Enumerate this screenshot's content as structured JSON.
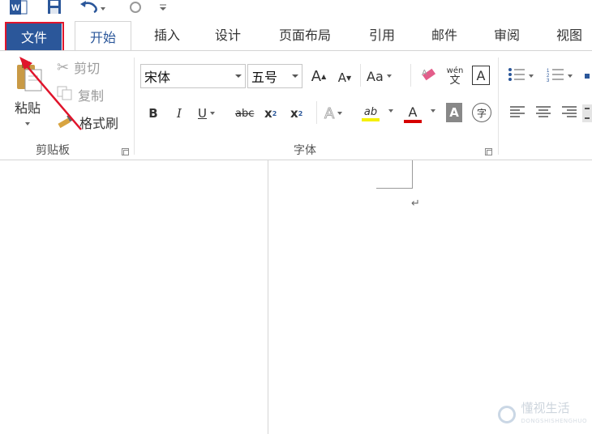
{
  "quick_access": {
    "app_icon": "word-icon",
    "save_icon": "save-icon",
    "undo_icon": "undo-icon",
    "redo_icon": "redo-icon",
    "customize_icon": "customize-qat-icon"
  },
  "tabs": [
    {
      "label": "文件"
    },
    {
      "label": "开始"
    },
    {
      "label": "插入"
    },
    {
      "label": "设计"
    },
    {
      "label": "页面布局"
    },
    {
      "label": "引用"
    },
    {
      "label": "邮件"
    },
    {
      "label": "审阅"
    },
    {
      "label": "视图"
    }
  ],
  "clipboard": {
    "paste_label": "粘贴",
    "cut_label": "剪切",
    "copy_label": "复制",
    "format_painter_label": "格式刷",
    "group_label": "剪贴板"
  },
  "font": {
    "font_name": "宋体",
    "font_size": "五号",
    "grow_label": "A",
    "shrink_label": "A",
    "change_case_label": "Aa",
    "phonetic_label": "wén",
    "phonetic_sub": "文",
    "char_border_label": "A",
    "bold_label": "B",
    "italic_label": "I",
    "underline_label": "U",
    "strike_label": "abc",
    "subscript_label": "x",
    "superscript_label": "x",
    "text_effect_label": "A",
    "highlight_label": "ab",
    "font_color_label": "A",
    "char_shading_label": "A",
    "enclose_label": "字",
    "group_label": "字体"
  },
  "doc": {
    "para_mark": "↵"
  },
  "watermark": {
    "text": "懂视生活",
    "sub": "DONGSHISHENGHUO"
  },
  "colors": {
    "accent": "#2b579a",
    "highlight_box": "#e0142b",
    "arrow": "#e0142b"
  }
}
